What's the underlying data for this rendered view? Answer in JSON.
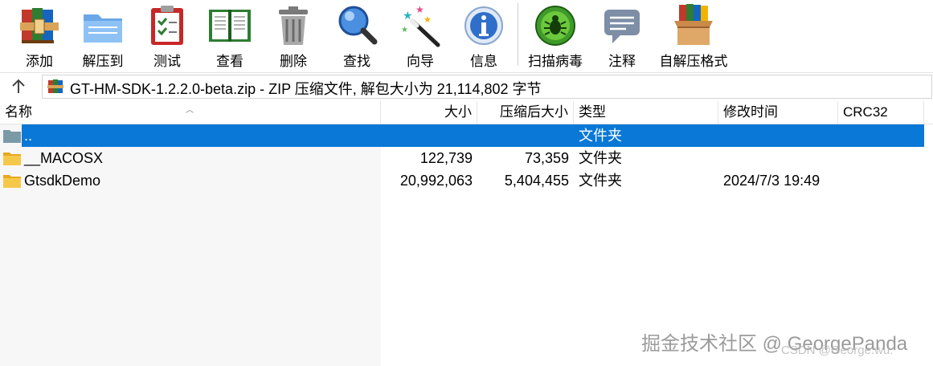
{
  "toolbar": {
    "buttons": [
      {
        "label": "添加",
        "icon": "books-add-icon"
      },
      {
        "label": "解压到",
        "icon": "folder-extract-icon"
      },
      {
        "label": "测试",
        "icon": "clipboard-check-icon"
      },
      {
        "label": "查看",
        "icon": "open-book-icon"
      },
      {
        "label": "删除",
        "icon": "trash-icon"
      },
      {
        "label": "查找",
        "icon": "magnifier-icon"
      },
      {
        "label": "向导",
        "icon": "magic-wand-icon"
      },
      {
        "label": "信息",
        "icon": "info-icon"
      },
      {
        "label": "扫描病毒",
        "icon": "virus-scan-icon"
      },
      {
        "label": "注释",
        "icon": "comment-icon"
      },
      {
        "label": "自解压格式",
        "icon": "sfx-box-icon"
      }
    ]
  },
  "address": {
    "text": "GT-HM-SDK-1.2.2.0-beta.zip - ZIP 压缩文件, 解包大小为 21,114,802 字节"
  },
  "columns": {
    "name": "名称",
    "size": "大小",
    "packed": "压缩后大小",
    "type": "类型",
    "modified": "修改时间",
    "crc": "CRC32"
  },
  "rows": [
    {
      "name": "..",
      "size": "",
      "packed": "",
      "type": "文件夹",
      "modified": "",
      "crc": "",
      "selected": true
    },
    {
      "name": "__MACOSX",
      "size": "122,739",
      "packed": "73,359",
      "type": "文件夹",
      "modified": "",
      "crc": ""
    },
    {
      "name": "GtsdkDemo",
      "size": "20,992,063",
      "packed": "5,404,455",
      "type": "文件夹",
      "modified": "2024/7/3 19:49",
      "crc": ""
    }
  ],
  "watermark": {
    "main": "掘金技术社区 @ GeorgePanda",
    "sub": "CSDN @George.wu."
  },
  "colors": {
    "selection": "#0a78d7",
    "folder": "#f4c040"
  }
}
